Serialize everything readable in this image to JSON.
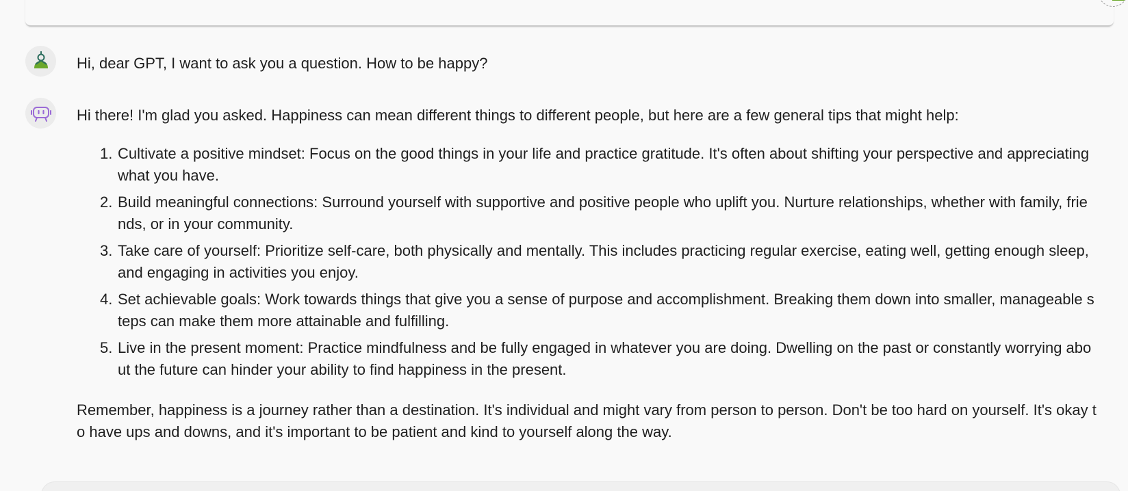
{
  "conversation": {
    "user_message": "Hi, dear GPT, I want to ask you a question. How to be happy?",
    "assistant": {
      "intro": "Hi there! I'm glad you asked. Happiness can mean different things to different people, but here are a few general tips that might help:",
      "tips": [
        {
          "number": "1.",
          "text": "Cultivate a positive mindset: Focus on the good things in your life and practice gratitude. It's often about shifting your perspective and appreciating what you have."
        },
        {
          "number": "2.",
          "text": "Build meaningful connections: Surround yourself with supportive and positive people who uplift you. Nurture relationships, whether with family, friends, or in your community."
        },
        {
          "number": "3.",
          "text": "Take care of yourself: Prioritize self-care, both physically and mentally. This includes practicing regular exercise, eating well, getting enough sleep, and engaging in activities you enjoy."
        },
        {
          "number": "4.",
          "text": "Set achievable goals: Work towards things that give you a sense of purpose and accomplishment. Breaking them down into smaller, manageable steps can make them more attainable and fulfilling."
        },
        {
          "number": "5.",
          "text": "Live in the present moment: Practice mindfulness and be fully engaged in whatever you are doing. Dwelling on the past or constantly worrying about the future can hinder your ability to find happiness in the present."
        }
      ],
      "closing": "Remember, happiness is a journey rather than a destination. It's individual and might vary from person to person. Don't be too hard on yourself. It's okay to have ups and downs, and it's important to be patient and kind to yourself along the way."
    }
  },
  "icons": {
    "user_avatar": "user-person-icon",
    "assistant_avatar": "robot-icon",
    "corner": "avatar-corner-icon"
  },
  "colors": {
    "background": "#f9f9f9",
    "user_avatar_green": "#6ba82b",
    "user_avatar_dark": "#2d6e5e",
    "bot_avatar_purple": "#9b6bd6",
    "text": "#1f1f1f"
  }
}
